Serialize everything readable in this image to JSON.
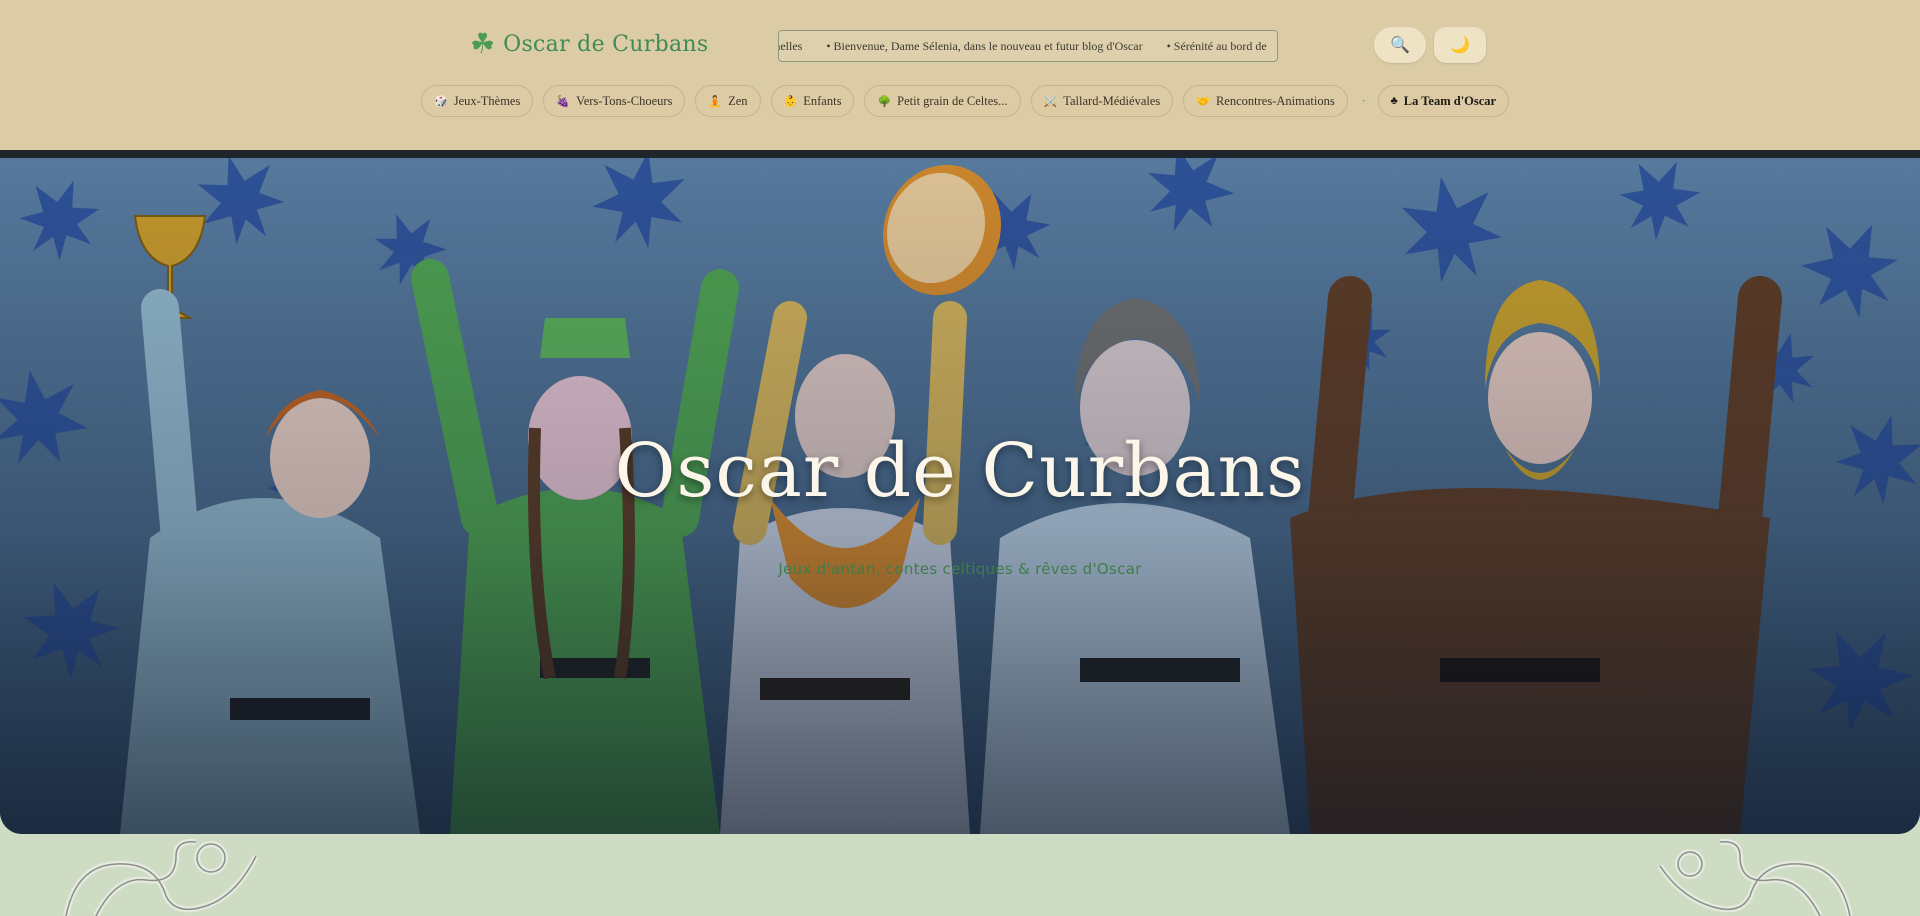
{
  "header": {
    "brand": {
      "icon": "shamrock-icon",
      "title": "Oscar de Curbans"
    },
    "ticker": {
      "items": [
        "ernelles",
        "• Bienvenue, Dame Sélenia, dans le nouveau et futur blog d'Oscar",
        "• Sérénité au bord de"
      ]
    },
    "search_button": {
      "icon": "search-icon",
      "glyph": "🔍"
    },
    "theme_button": {
      "icon": "moon-icon",
      "glyph": "🌙"
    },
    "nav": [
      {
        "icon": "dice-icon",
        "glyph": "🎲",
        "label": "Jeux-Thèmes"
      },
      {
        "icon": "grapes-icon",
        "glyph": "🍇",
        "label": "Vers-Tons-Choeurs"
      },
      {
        "icon": "meditation-icon",
        "glyph": "🧘",
        "label": "Zen"
      },
      {
        "icon": "child-icon",
        "glyph": "👶",
        "label": "Enfants"
      },
      {
        "icon": "tree-icon",
        "glyph": "🌳",
        "label": "Petit grain de Celtes..."
      },
      {
        "icon": "swords-icon",
        "glyph": "⚔️",
        "label": "Tallard-Médiévales"
      },
      {
        "icon": "handshake-icon",
        "glyph": "🤝",
        "label": "Rencontres-Animations"
      }
    ],
    "nav_separator": "·",
    "team": {
      "icon": "club-icon",
      "glyph": "♣",
      "label": "La Team d'Oscar"
    }
  },
  "hero": {
    "title": "Oscar de Curbans",
    "subtitle": "Jeux d'antan, contes celtiques & rêves d'Oscar"
  },
  "colors": {
    "header_bg": "#dccca6",
    "brand_green": "#3f8a55",
    "hero_bg": "#4d6c8d",
    "footer_bg": "#cfdcc4"
  }
}
